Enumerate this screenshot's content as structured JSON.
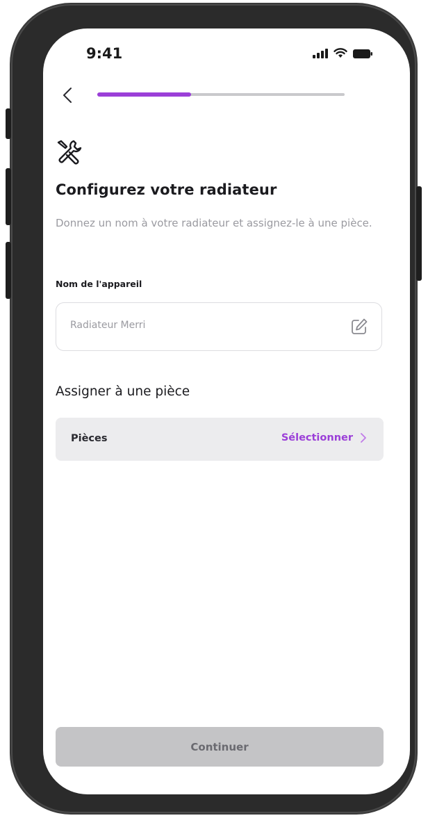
{
  "status_bar": {
    "time": "9:41"
  },
  "progress": {
    "fraction": 0.38
  },
  "header": {
    "title": "Configurez votre radiateur",
    "subtitle": "Donnez un nom à votre radiateur et assignez-le à une pièce."
  },
  "device_name": {
    "label": "Nom de l'appareil",
    "value": "Radiateur Merri"
  },
  "room": {
    "section_title": "Assigner à une pièce",
    "row_label": "Pièces",
    "action_label": "Sélectionner"
  },
  "footer": {
    "continue_label": "Continuer"
  },
  "colors": {
    "accent": "#9b3fd8",
    "disabled_button": "#c4c4c6"
  },
  "icons": [
    "back-chevron",
    "tools",
    "edit",
    "chevron-right",
    "signal",
    "wifi",
    "battery"
  ]
}
